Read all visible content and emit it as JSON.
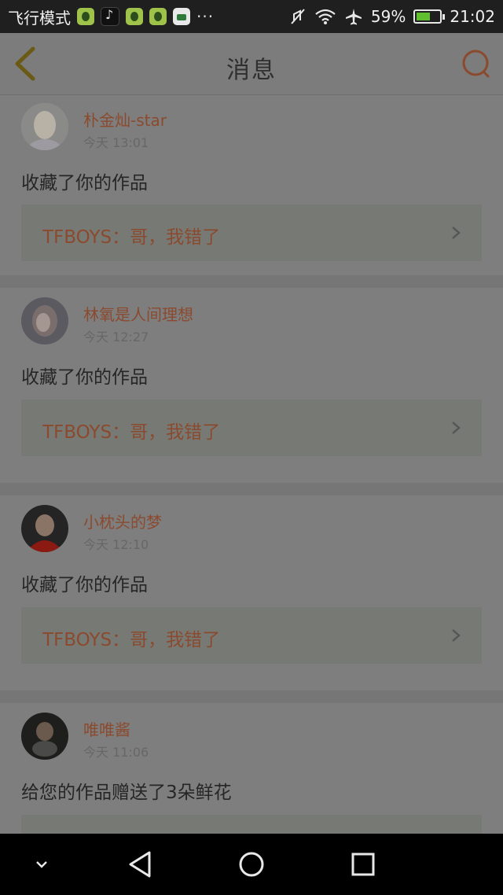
{
  "status_bar": {
    "mode_label": "飞行模式",
    "overflow": "···",
    "battery_percent": "59%",
    "battery_level": 0.59,
    "time": "21:02"
  },
  "header": {
    "title": "消息"
  },
  "messages": [
    {
      "name": "朴金灿-star",
      "time": "今天 13:01",
      "action": "收藏了你的作品",
      "work_title": "TFBOYS：哥，我错了"
    },
    {
      "name": "林氧是人间理想",
      "time": "今天 12:27",
      "action": "收藏了你的作品",
      "work_title": "TFBOYS：哥，我错了"
    },
    {
      "name": "小枕头的梦",
      "time": "今天 12:10",
      "action": "收藏了你的作品",
      "work_title": "TFBOYS：哥，我错了"
    },
    {
      "name": "唯唯酱",
      "time": "今天 11:06",
      "action": "给您的作品赠送了3朵鲜花",
      "work_title": ""
    }
  ],
  "colors": {
    "accent": "#8b4a2e",
    "overlay_bg": "#7e7e7e",
    "battery_green": "#5fbf2f"
  },
  "icons": {
    "back": "chevron-left-icon",
    "search": "search-icon",
    "nav_down": "chevron-down-icon",
    "nav_back": "triangle-back-icon",
    "nav_home": "circle-home-icon",
    "nav_recents": "square-recents-icon"
  }
}
